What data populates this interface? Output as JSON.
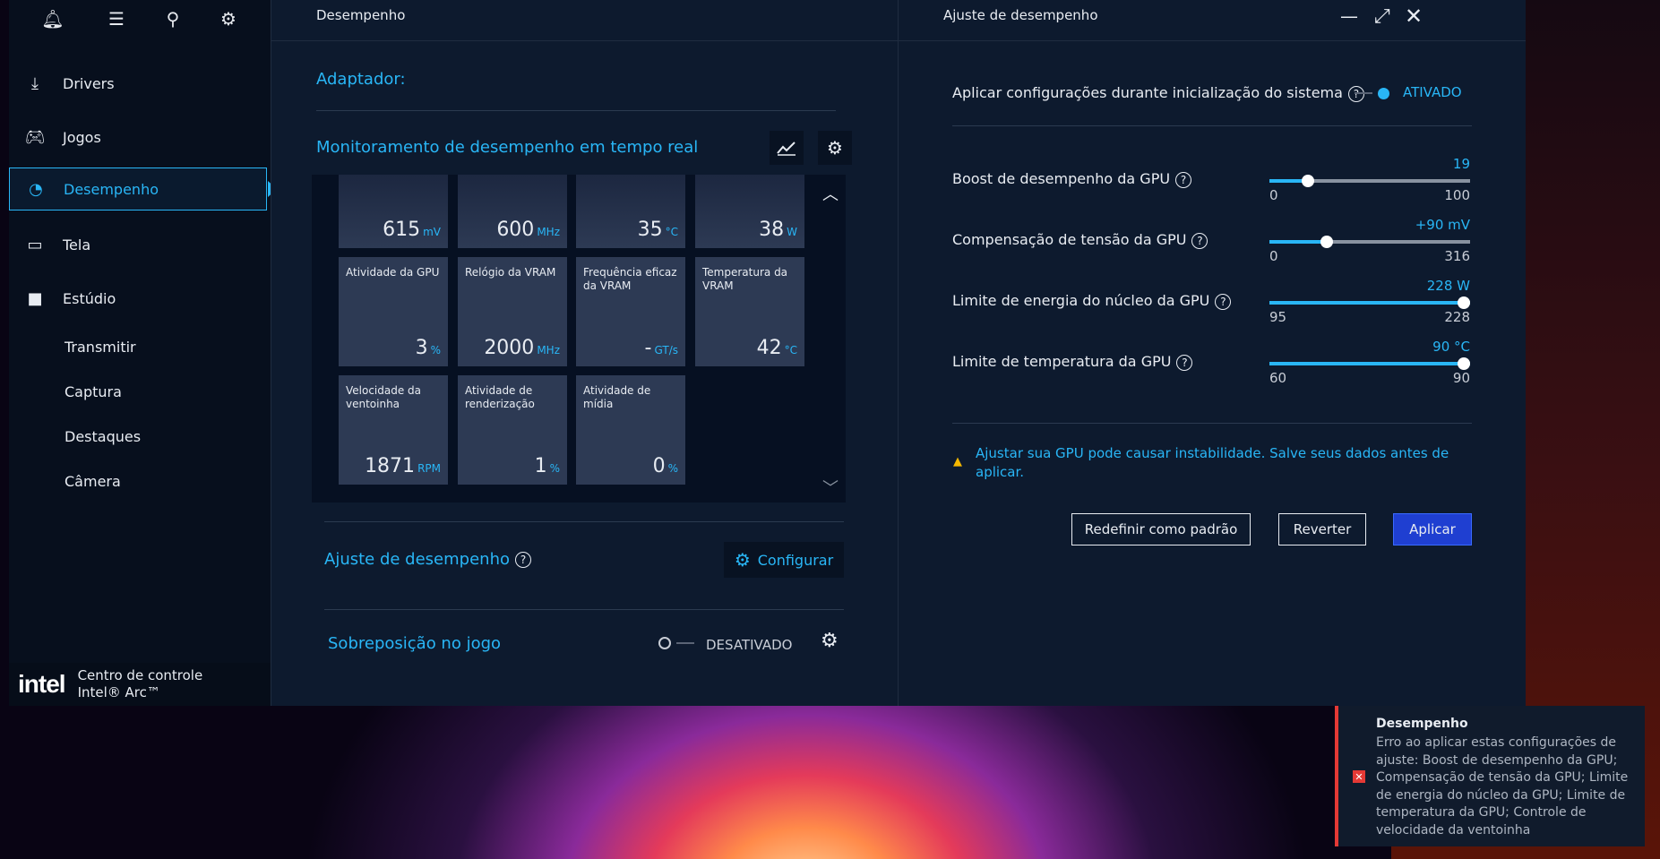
{
  "sidebar": {
    "items": [
      {
        "label": "Drivers",
        "icon": "download-icon"
      },
      {
        "label": "Jogos",
        "icon": "gamepad-icon"
      },
      {
        "label": "Desempenho",
        "icon": "gauge-icon"
      },
      {
        "label": "Tela",
        "icon": "monitor-icon"
      },
      {
        "label": "Estúdio",
        "icon": "camera-icon"
      }
    ],
    "subitems": [
      "Transmitir",
      "Captura",
      "Destaques",
      "Câmera"
    ],
    "brand_logo": "intel",
    "brand_line1": "Centro de controle",
    "brand_line2": "Intel® Arc™"
  },
  "middle": {
    "header": "Desempenho",
    "adapter_label": "Adaptador:",
    "monitor_title": "Monitoramento de desempenho em tempo real",
    "tiles": [
      {
        "label": "",
        "value": "615",
        "unit": "mV"
      },
      {
        "label": "",
        "value": "600",
        "unit": "MHz"
      },
      {
        "label": "",
        "value": "35",
        "unit": "°C"
      },
      {
        "label": "",
        "value": "38",
        "unit": "W"
      },
      {
        "label": "Atividade da GPU",
        "value": "3",
        "unit": "%"
      },
      {
        "label": "Relógio da VRAM",
        "value": "2000",
        "unit": "MHz"
      },
      {
        "label": "Frequência eficaz da VRAM",
        "value": "-",
        "unit": "GT/s"
      },
      {
        "label": "Temperatura da VRAM",
        "value": "42",
        "unit": "°C"
      },
      {
        "label": "Velocidade da ventoinha",
        "value": "1871",
        "unit": "RPM"
      },
      {
        "label": "Atividade de renderização",
        "value": "1",
        "unit": "%"
      },
      {
        "label": "Atividade de mídia",
        "value": "0",
        "unit": "%"
      }
    ],
    "tuning_title": "Ajuste de desempenho",
    "configure_label": "Configurar",
    "overlay_title": "Sobreposição no jogo",
    "overlay_state": "DESATIVADO"
  },
  "right": {
    "header": "Ajuste de desempenho",
    "apply_on_boot": "Aplicar configurações durante inicialização do sistema",
    "apply_on_boot_state": "ATIVADO",
    "sliders": [
      {
        "label": "Boost de desempenho da GPU",
        "value": "19",
        "min": "0",
        "max": "100",
        "fraction": 0.19
      },
      {
        "label": "Compensação de tensão da GPU",
        "value": "+90 mV",
        "min": "0",
        "max": "316",
        "fraction": 0.285
      },
      {
        "label": "Limite de energia do núcleo da GPU",
        "value": "228 W",
        "min": "95",
        "max": "228",
        "fraction": 1.0
      },
      {
        "label": "Limite de temperatura da GPU",
        "value": "90 °C",
        "min": "60",
        "max": "90",
        "fraction": 1.0
      }
    ],
    "warning": "Ajustar sua GPU pode causar instabilidade. Salve seus dados antes de aplicar.",
    "btn_reset": "Redefinir como padrão",
    "btn_revert": "Reverter",
    "btn_apply": "Aplicar"
  },
  "toast": {
    "title": "Desempenho",
    "message": "Erro ao aplicar estas configurações de ajuste: Boost de desempenho da GPU; Compensação de tensão da GPU; Limite de energia do núcleo da GPU; Limite de temperatura da GPU; Controle de velocidade da ventoinha"
  },
  "colors": {
    "accent": "#29b6f6",
    "app_bg": "#0b1628",
    "error": "#e53935",
    "primary_button": "#1f3fd1"
  }
}
